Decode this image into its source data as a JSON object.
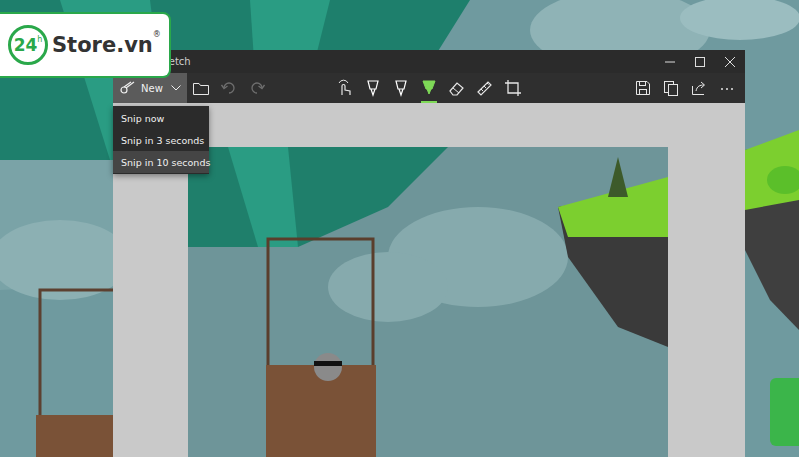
{
  "logo": {
    "number": "24",
    "superscript": "h",
    "name": "Store.vn",
    "mark": "®"
  },
  "window": {
    "title": "Snip & Sketch"
  },
  "new_button": {
    "label": "New",
    "expanded": true
  },
  "menu": [
    {
      "label": "Snip now",
      "selected": false
    },
    {
      "label": "Snip in 3 seconds",
      "selected": false
    },
    {
      "label": "Snip in 10 seconds",
      "selected": true
    }
  ],
  "history": [
    {
      "kind": "undo",
      "disabled": true
    },
    {
      "kind": "redo",
      "disabled": true
    }
  ],
  "tools": [
    {
      "kind": "touch",
      "selected": false,
      "color": "#e6e6e6"
    },
    {
      "kind": "pen",
      "selected": false,
      "color": "#ffffff"
    },
    {
      "kind": "pencil",
      "selected": false,
      "color": "#ffffff"
    },
    {
      "kind": "highlighter",
      "selected": true,
      "color": "#7ed957"
    },
    {
      "kind": "eraser",
      "selected": false,
      "color": "#e6e6e6"
    },
    {
      "kind": "ruler",
      "selected": false,
      "color": "#e6e6e6"
    },
    {
      "kind": "crop",
      "selected": false,
      "color": "#e6e6e6"
    }
  ],
  "actions": [
    {
      "kind": "save"
    },
    {
      "kind": "copy"
    },
    {
      "kind": "share"
    },
    {
      "kind": "more"
    }
  ]
}
